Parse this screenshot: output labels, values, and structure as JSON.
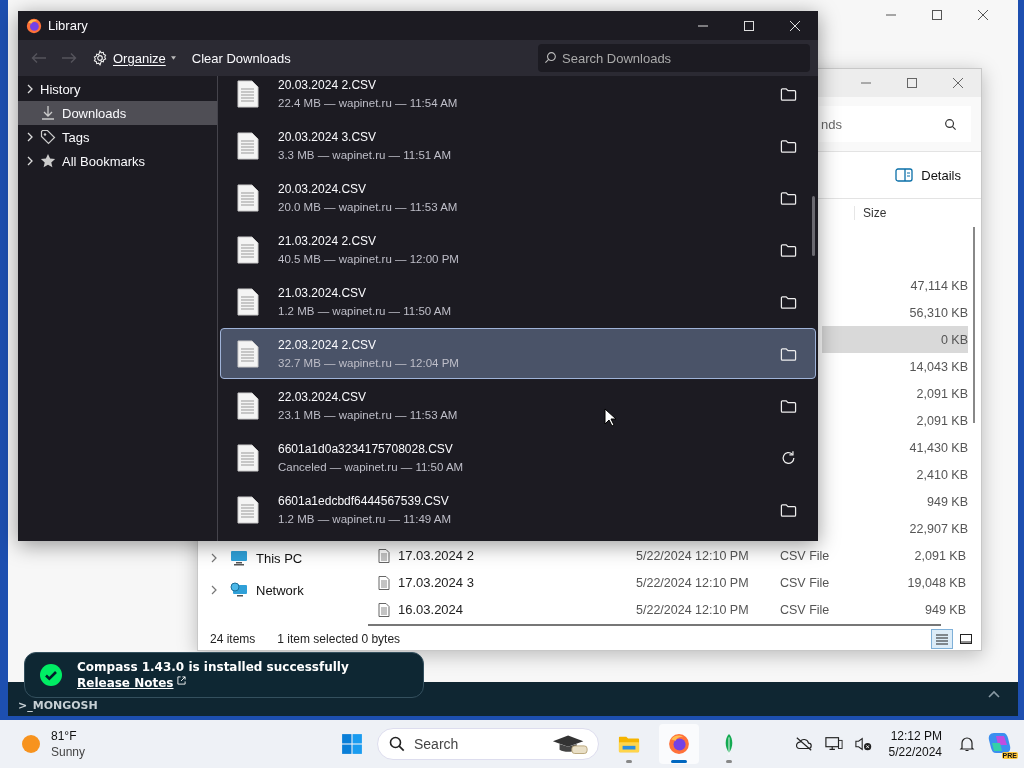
{
  "background_app": {
    "shell_label": ">_MONGOSH",
    "toast": {
      "title": "Compass 1.43.0 is installed successfully",
      "link": "Release Notes"
    }
  },
  "explorer": {
    "search_placeholder": "nds",
    "view_label": "Details",
    "size_header": "Size",
    "rows": [
      {
        "size": "47,114 KB",
        "selected": false
      },
      {
        "size": "56,310 KB",
        "selected": false
      },
      {
        "size": "0 KB",
        "selected": true
      },
      {
        "size": "14,043 KB",
        "selected": false
      },
      {
        "size": "2,091 KB",
        "selected": false
      },
      {
        "size": "2,091 KB",
        "selected": false
      },
      {
        "size": "41,430 KB",
        "selected": false
      },
      {
        "size": "2,410 KB",
        "selected": false
      },
      {
        "size": "949 KB",
        "selected": false
      },
      {
        "size": "22,907 KB",
        "selected": false
      },
      {
        "name": "17.03.2024 2",
        "date": "5/22/2024 12:10 PM",
        "type": "CSV File",
        "size": "2,091 KB",
        "selected": false
      },
      {
        "name": "17.03.2024 3",
        "date": "5/22/2024 12:10 PM",
        "type": "CSV File",
        "size": "19,048 KB",
        "selected": false
      },
      {
        "name": "16.03.2024",
        "date": "5/22/2024 12:10 PM",
        "type": "CSV File",
        "size": "949 KB",
        "selected": false
      }
    ],
    "nav": [
      {
        "label": "This PC",
        "kind": "pc"
      },
      {
        "label": "Network",
        "kind": "network"
      }
    ],
    "status": {
      "count": "24 items",
      "selection": "1 item selected  0 bytes"
    },
    "views": [
      {
        "kind": "details",
        "selected": true
      },
      {
        "kind": "tiles",
        "selected": false
      }
    ]
  },
  "library": {
    "title": "Library",
    "organize": "Organize",
    "clear": "Clear Downloads",
    "search_placeholder": "Search Downloads",
    "sidebar": [
      {
        "label": "History",
        "kind": "none",
        "expandable": true,
        "selected": false
      },
      {
        "label": "Downloads",
        "kind": "download",
        "expandable": false,
        "selected": true
      },
      {
        "label": "Tags",
        "kind": "tag",
        "expandable": true,
        "selected": false
      },
      {
        "label": "All Bookmarks",
        "kind": "star",
        "expandable": true,
        "selected": false
      }
    ],
    "downloads": [
      {
        "name": "20.03.2024 2.CSV",
        "details": "22.4 MB — wapinet.ru — 11:54 AM",
        "kind": "finished",
        "selected": false
      },
      {
        "name": "20.03.2024 3.CSV",
        "details": "3.3 MB — wapinet.ru — 11:51 AM",
        "kind": "finished",
        "selected": false
      },
      {
        "name": "20.03.2024.CSV",
        "details": "20.0 MB — wapinet.ru — 11:53 AM",
        "kind": "finished",
        "selected": false
      },
      {
        "name": "21.03.2024 2.CSV",
        "details": "40.5 MB — wapinet.ru — 12:00 PM",
        "kind": "finished",
        "selected": false
      },
      {
        "name": "21.03.2024.CSV",
        "details": "1.2 MB — wapinet.ru — 11:50 AM",
        "kind": "finished",
        "selected": false
      },
      {
        "name": "22.03.2024 2.CSV",
        "details": "32.7 MB — wapinet.ru — 12:04 PM",
        "kind": "finished",
        "selected": true
      },
      {
        "name": "22.03.2024.CSV",
        "details": "23.1 MB — wapinet.ru — 11:53 AM",
        "kind": "finished",
        "selected": false
      },
      {
        "name": "6601a1d0a3234175708028.CSV",
        "details": "Canceled — wapinet.ru — 11:50 AM",
        "kind": "canceled",
        "selected": false
      },
      {
        "name": "6601a1edcbdf6444567539.CSV",
        "details": "1.2 MB — wapinet.ru — 11:49 AM",
        "kind": "finished",
        "selected": false
      }
    ]
  },
  "taskbar": {
    "temperature": "81°F",
    "condition": "Sunny",
    "search_placeholder": "Search",
    "apps": [
      {
        "kind": "files",
        "active": false
      },
      {
        "kind": "firefox",
        "active": true
      },
      {
        "kind": "compass",
        "active": false
      }
    ],
    "time": "12:12 PM",
    "date": "5/22/2024",
    "copilot_badge": "PRE"
  }
}
